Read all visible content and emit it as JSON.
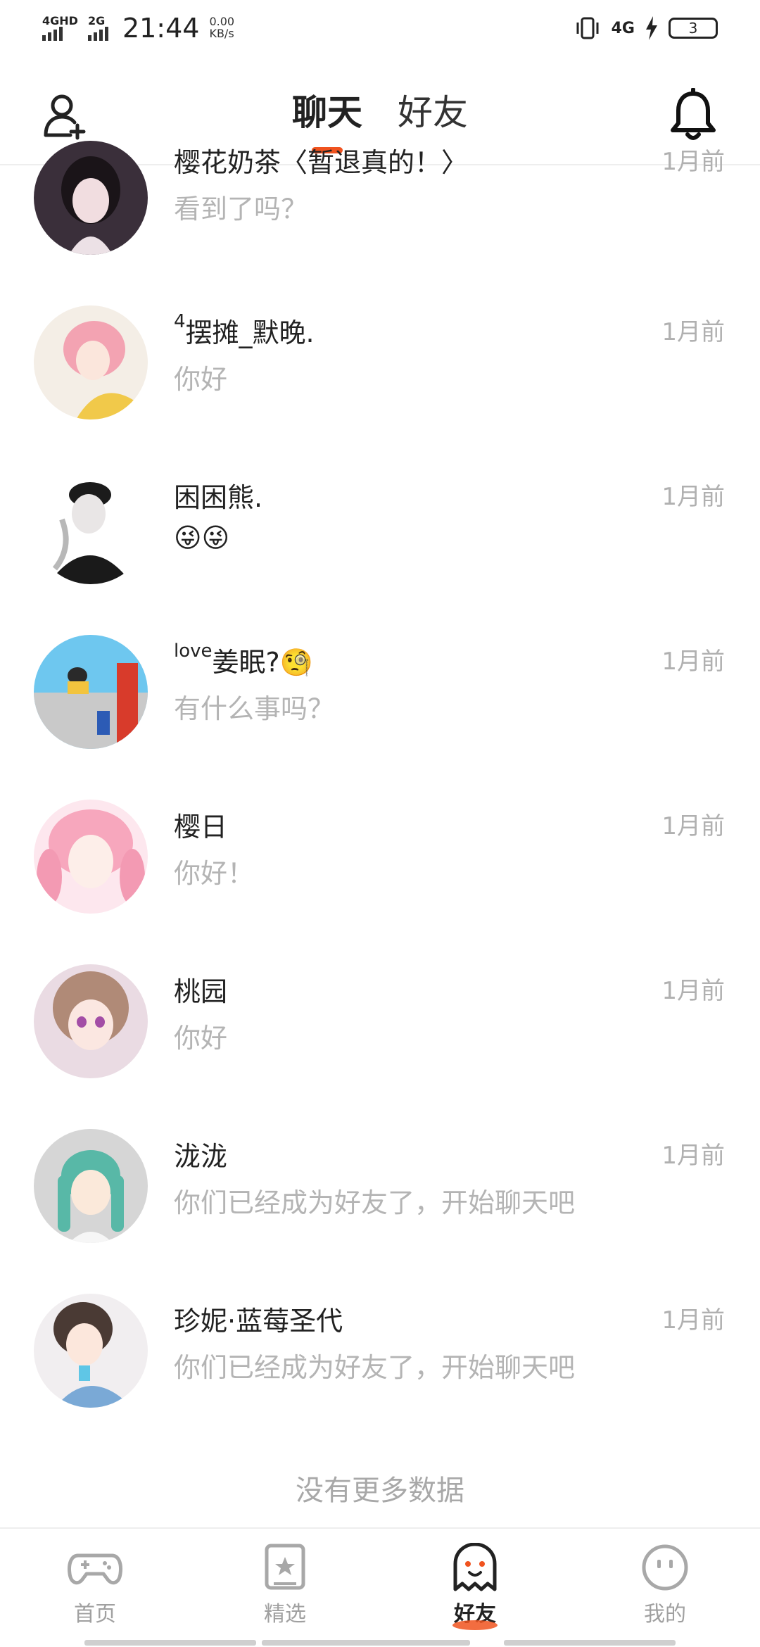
{
  "status_bar": {
    "signal1_label": "4GHD",
    "signal2_label": "2G",
    "time": "21:44",
    "speed_value": "0.00",
    "speed_unit": "KB/s",
    "network": "4G",
    "battery": "3"
  },
  "header": {
    "tabs": [
      {
        "label": "聊天",
        "active": true
      },
      {
        "label": "好友",
        "active": false
      }
    ],
    "add_friend_icon": "add-user-icon",
    "bell_icon": "bell-icon"
  },
  "chats": [
    {
      "name": "樱花奶茶〈暂退真的！〉",
      "message": "看到了吗？",
      "time": "1月前"
    },
    {
      "name_sup": "4",
      "name": "摆摊_默晚.",
      "message": "你好",
      "time": "1月前"
    },
    {
      "name": "困困熊.",
      "message": "😜😜",
      "time": "1月前"
    },
    {
      "name_sup": "love",
      "name": "姜眠?🧐",
      "message": "有什么事吗？",
      "time": "1月前"
    },
    {
      "name": "樱日",
      "message": "你好！",
      "time": "1月前"
    },
    {
      "name": "桃园",
      "message": "你好",
      "time": "1月前"
    },
    {
      "name": "泷泷",
      "message": "你们已经成为好友了，开始聊天吧",
      "time": "1月前"
    },
    {
      "name": "珍妮·蓝莓圣代",
      "message": "你们已经成为好友了，开始聊天吧",
      "time": "1月前"
    }
  ],
  "no_more": "没有更多数据",
  "bottom_nav": [
    {
      "label": "首页",
      "icon": "gamepad-icon",
      "active": false
    },
    {
      "label": "精选",
      "icon": "star-card-icon",
      "active": false
    },
    {
      "label": "好友",
      "icon": "ghost-icon",
      "active": true
    },
    {
      "label": "我的",
      "icon": "smiley-icon",
      "active": false
    }
  ],
  "colors": {
    "accent": "#f0531f",
    "muted": "#b4b4b4"
  }
}
